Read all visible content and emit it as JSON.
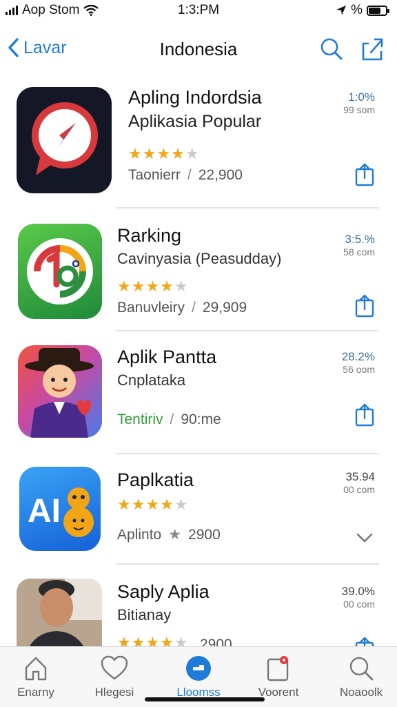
{
  "status_bar": {
    "carrier": "Aop Stom",
    "time": "1:3:PM",
    "battery_text": "%"
  },
  "nav": {
    "back_label": "Lavar",
    "title": "Indonesia"
  },
  "apps": [
    {
      "name": "Apling Indordsia",
      "subtitle": "Aplikasia Popular",
      "rating": 4,
      "meta_left": "Taonierr",
      "meta_sep": "/",
      "meta_right": "22,900",
      "pct": "1:0%",
      "size": "99 som"
    },
    {
      "name": "Rarking",
      "subtitle": "Cavinyasia (Peasudday)",
      "rating": 4,
      "meta_left": "Banuvleiry",
      "meta_sep": "/",
      "meta_right": "29,909",
      "pct": "3:5.%",
      "size": "58 com"
    },
    {
      "name": "Aplik Pantta",
      "subtitle": "Cnplataka",
      "meta_left": "Tentiriv",
      "meta_sep": "/",
      "meta_right": "90:me",
      "pct": "28.2%",
      "size": "56 oom"
    },
    {
      "name": "Paplkatia",
      "rating": 4,
      "meta_left": "Aplinto",
      "meta_sep": "★",
      "meta_right": "2900",
      "pct": "35.94",
      "size": "00 com"
    },
    {
      "name": "Saply Aplia",
      "subtitle": "Bitianay",
      "rating": 4,
      "meta_right": "2900",
      "pct": "39.0%",
      "size": "00 com"
    }
  ],
  "tabs": [
    {
      "label": "Enarny",
      "icon": "home-icon"
    },
    {
      "label": "Hlegesi",
      "icon": "heart-icon"
    },
    {
      "label": "Lloomss",
      "icon": "apps-icon",
      "active": true
    },
    {
      "label": "Voorent",
      "icon": "tablet-icon"
    },
    {
      "label": "Noaoolk",
      "icon": "search-icon"
    }
  ],
  "colors": {
    "accent": "#1e7bd8",
    "star": "#f3a615",
    "green_text": "#2e9e3a"
  }
}
